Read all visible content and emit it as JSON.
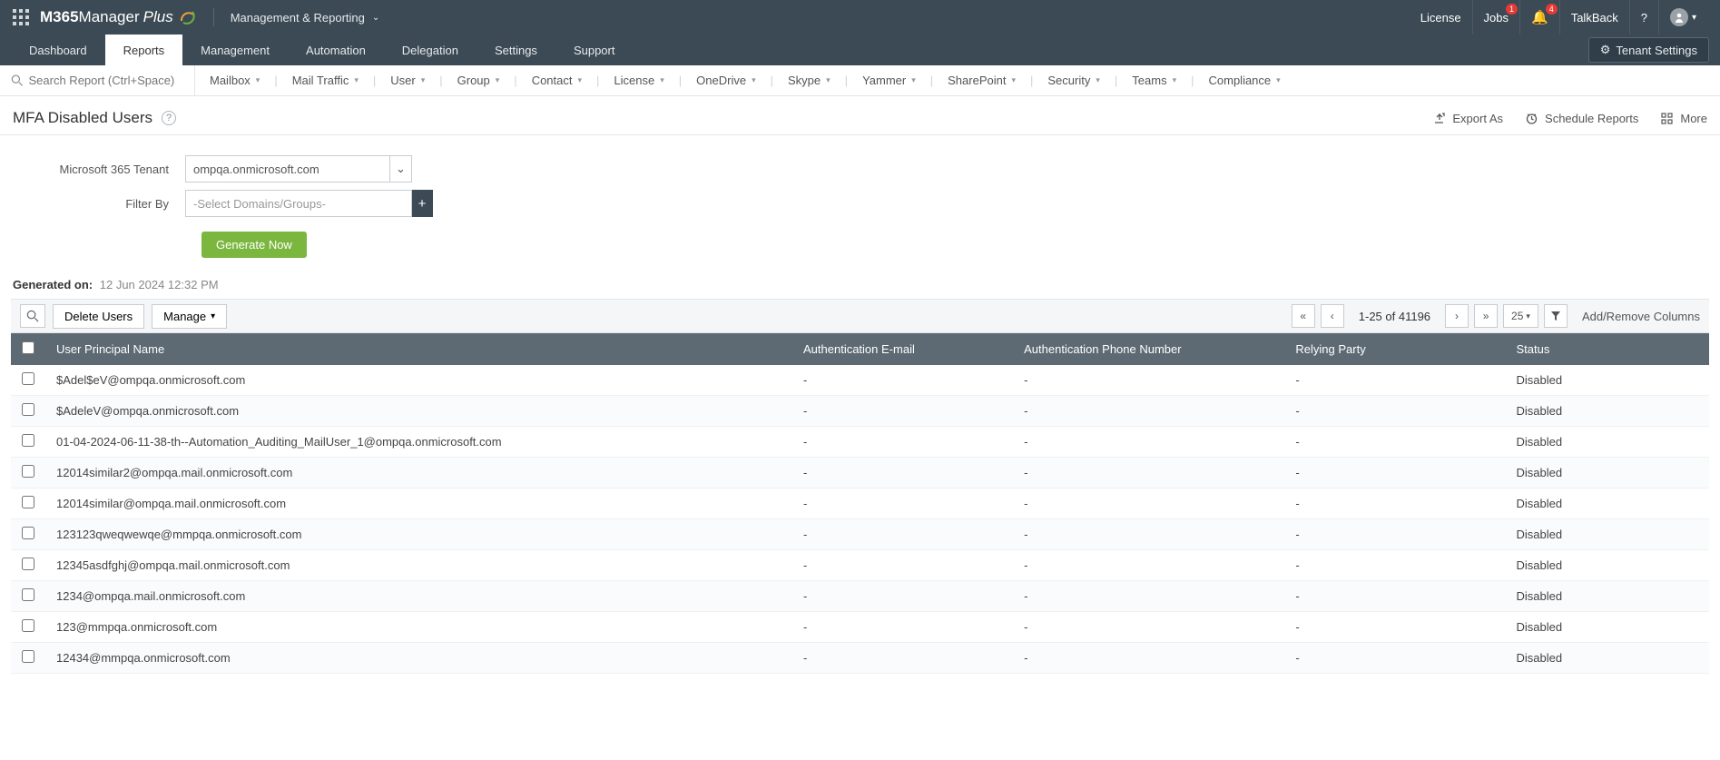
{
  "brand": {
    "m365": "M365",
    "manager": " Manager",
    "plus": "Plus"
  },
  "module_dropdown": "Management & Reporting",
  "top_links": {
    "license": "License",
    "jobs": "Jobs",
    "jobs_badge": "1",
    "bell_badge": "4",
    "talkback": "TalkBack"
  },
  "tabs": [
    "Dashboard",
    "Reports",
    "Management",
    "Automation",
    "Delegation",
    "Settings",
    "Support"
  ],
  "tenant_settings": "Tenant Settings",
  "search_placeholder": "Search Report (Ctrl+Space)",
  "filter_menu": [
    "Mailbox",
    "Mail Traffic",
    "User",
    "Group",
    "Contact",
    "License",
    "OneDrive",
    "Skype",
    "Yammer",
    "SharePoint",
    "Security",
    "Teams",
    "Compliance"
  ],
  "page_title": "MFA Disabled Users",
  "actions": {
    "export": "Export As",
    "schedule": "Schedule Reports",
    "more": "More"
  },
  "form": {
    "tenant_label": "Microsoft 365 Tenant",
    "tenant_value": "ompqa.onmicrosoft.com",
    "filter_label": "Filter By",
    "filter_placeholder": "-Select Domains/Groups-",
    "generate": "Generate Now"
  },
  "gen_on_label": "Generated on:",
  "gen_on_value": "12 Jun 2024 12:32 PM",
  "toolbar": {
    "delete": "Delete Users",
    "manage": "Manage",
    "page_info": "1-25 of 41196",
    "page_size": "25",
    "add_remove": "Add/Remove Columns"
  },
  "columns": [
    "User Principal Name",
    "Authentication E-mail",
    "Authentication Phone Number",
    "Relying Party",
    "Status"
  ],
  "rows": [
    {
      "upn": "$Adel$eV@ompqa.onmicrosoft.com",
      "email": "-",
      "phone": "-",
      "rp": "-",
      "status": "Disabled"
    },
    {
      "upn": "$AdeleV@ompqa.onmicrosoft.com",
      "email": "-",
      "phone": "-",
      "rp": "-",
      "status": "Disabled"
    },
    {
      "upn": "01-04-2024-06-11-38-th--Automation_Auditing_MailUser_1@ompqa.onmicrosoft.com",
      "email": "-",
      "phone": "-",
      "rp": "-",
      "status": "Disabled"
    },
    {
      "upn": "12014similar2@ompqa.mail.onmicrosoft.com",
      "email": "-",
      "phone": "-",
      "rp": "-",
      "status": "Disabled"
    },
    {
      "upn": "12014similar@ompqa.mail.onmicrosoft.com",
      "email": "-",
      "phone": "-",
      "rp": "-",
      "status": "Disabled"
    },
    {
      "upn": "123123qweqwewqe@mmpqa.onmicrosoft.com",
      "email": "-",
      "phone": "-",
      "rp": "-",
      "status": "Disabled"
    },
    {
      "upn": "12345asdfghj@ompqa.mail.onmicrosoft.com",
      "email": "-",
      "phone": "-",
      "rp": "-",
      "status": "Disabled"
    },
    {
      "upn": "1234@ompqa.mail.onmicrosoft.com",
      "email": "-",
      "phone": "-",
      "rp": "-",
      "status": "Disabled"
    },
    {
      "upn": "123@mmpqa.onmicrosoft.com",
      "email": "-",
      "phone": "-",
      "rp": "-",
      "status": "Disabled"
    },
    {
      "upn": "12434@mmpqa.onmicrosoft.com",
      "email": "-",
      "phone": "-",
      "rp": "-",
      "status": "Disabled"
    }
  ]
}
